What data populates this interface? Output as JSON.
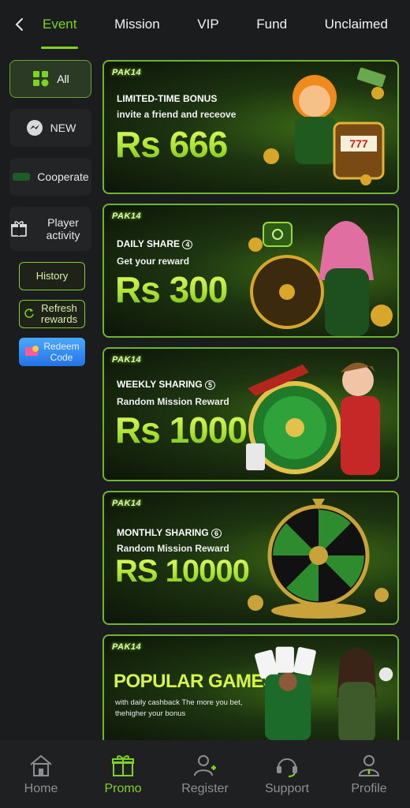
{
  "tabs": [
    "Event",
    "Mission",
    "VIP",
    "Fund",
    "Unclaimed"
  ],
  "active_tab": "Event",
  "sidebar": {
    "items": [
      {
        "label": "All",
        "icon": "grid-icon"
      },
      {
        "label": "NEW",
        "icon": "messenger-icon"
      },
      {
        "label": "Cooperate",
        "icon": "handshake-icon"
      },
      {
        "label": "Player activity",
        "icon": "gift-icon"
      }
    ],
    "history_label": "History",
    "refresh_label": "Refresh rewards",
    "redeem_label": "Redeem Code"
  },
  "banners": [
    {
      "logo": "PAK14",
      "subtitle": "LIMITED-TIME BONUS",
      "desc": "invite a friend and receove",
      "amount": "Rs 666"
    },
    {
      "logo": "PAK14",
      "subtitle": "DAILY SHARE",
      "badge": "4",
      "desc": "Get your reward",
      "amount": "Rs 300"
    },
    {
      "logo": "PAK14",
      "subtitle": "WEEKLY SHARING",
      "badge": "5",
      "desc": "Random Mission Reward",
      "amount": "Rs 1000"
    },
    {
      "logo": "PAK14",
      "subtitle": "MONTHLY SHARING",
      "badge": "6",
      "desc": "Random Mission Reward",
      "amount": "RS 10000"
    },
    {
      "logo": "PAK14",
      "headline": "POPULAR GAMES",
      "desc": "with daily cashback The more you bet, thehigher your bonus"
    }
  ],
  "bottom_nav": [
    {
      "label": "Home",
      "icon": "home-icon"
    },
    {
      "label": "Promo",
      "icon": "gift-icon"
    },
    {
      "label": "Register",
      "icon": "add-user-icon"
    },
    {
      "label": "Support",
      "icon": "headset-icon"
    },
    {
      "label": "Profile",
      "icon": "user-icon"
    }
  ],
  "active_nav": "Promo",
  "colors": {
    "accent": "#7dd321",
    "background": "#1b1c1e",
    "redeem": "#3a8cf5"
  }
}
